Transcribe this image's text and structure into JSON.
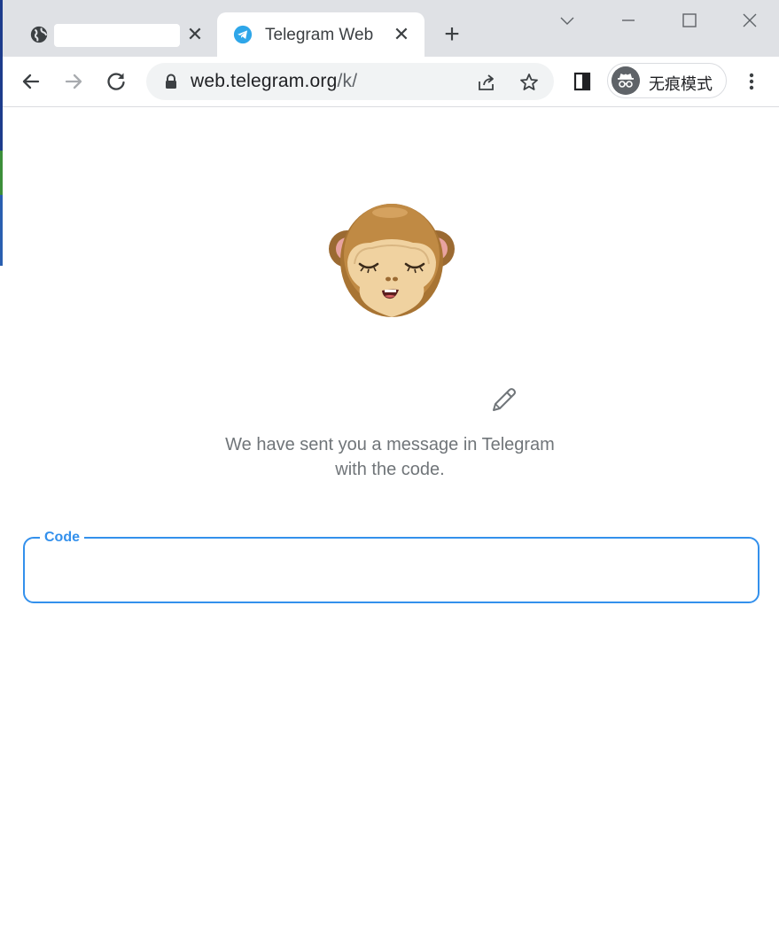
{
  "browser": {
    "tabs": [
      {
        "title": "",
        "favicon": "globe-icon",
        "active": false
      },
      {
        "title": "Telegram Web",
        "favicon": "telegram-icon",
        "active": true
      }
    ],
    "close_glyph": "✕",
    "new_tab_glyph": "+",
    "omnibox": {
      "url_host": "web.telegram.org",
      "url_path": "/k/"
    },
    "incognito_label": "无痕模式",
    "accent_color": "#3390ec"
  },
  "page": {
    "sticker": "monkey-closed-eyes",
    "phone_number": "",
    "subtitle_line1": "We have sent you a message in Telegram",
    "subtitle_line2": "with the code.",
    "code_field": {
      "label": "Code",
      "value": ""
    }
  }
}
